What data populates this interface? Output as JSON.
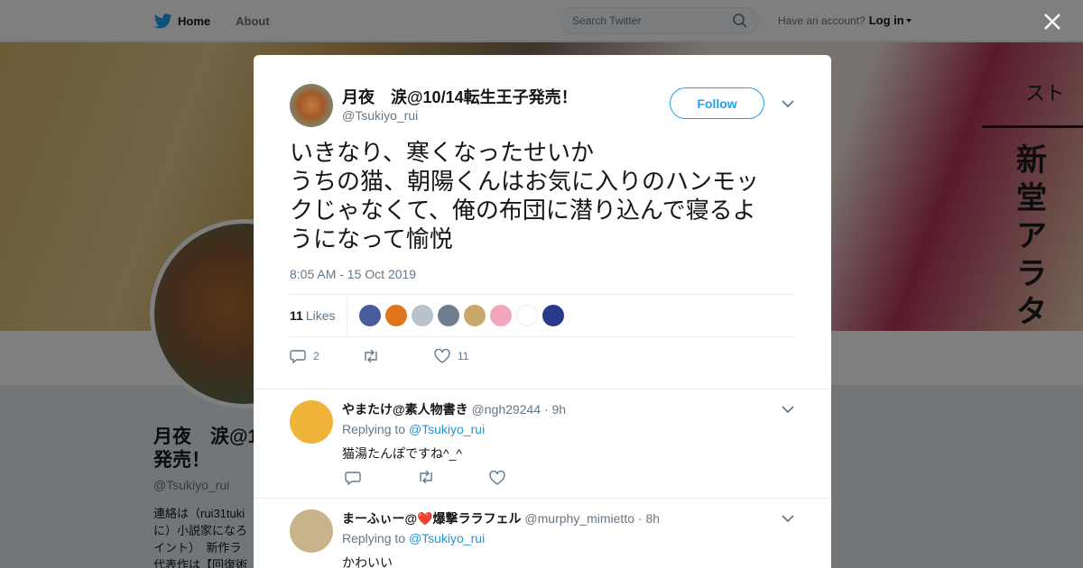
{
  "nav": {
    "home": "Home",
    "about": "About",
    "search_placeholder": "Search Twitter",
    "have_account": "Have an account?",
    "login": "Log in"
  },
  "background": {
    "banner_top": "スト",
    "banner_text": "新堂アラタ",
    "profile_name_line1": "月夜　涙@1",
    "profile_name_line2": "発売！",
    "profile_handle": "@Tsukiyo_rui",
    "bio_lines": [
      "連絡は（rui31tuki",
      "に）小説家になろ",
      "イント）　新作ラ",
      "代表作は【回復術"
    ]
  },
  "tweet": {
    "author_name": "月夜　涙@10/14転生王子発売！",
    "author_handle": "@Tsukiyo_rui",
    "follow_label": "Follow",
    "text_lines": [
      "いきなり、寒くなったせいか",
      "うちの猫、朝陽くんはお気に入りのハンモッ",
      "クじゃなくて、俺の布団に潜り込んで寝るよ",
      "うになって愉悦"
    ],
    "timestamp": "8:05 AM - 15 Oct 2019",
    "likes_count": "11",
    "likes_label": "Likes",
    "reply_count": "2",
    "like_count": "11"
  },
  "likers": [
    {
      "color": "#4a5b9c",
      "icon": "avatar"
    },
    {
      "color": "#e0761c",
      "icon": "avatar"
    },
    {
      "color": "#b8c2cc",
      "icon": "avatar"
    },
    {
      "color": "#6f7d8f",
      "icon": "avatar"
    },
    {
      "color": "#c9a86b",
      "icon": "avatar"
    },
    {
      "color": "#f2a7bd",
      "icon": "avatar"
    },
    {
      "color": "#ffffff",
      "icon": "avatar"
    },
    {
      "color": "#2a3a8a",
      "icon": "avatar"
    }
  ],
  "replies": [
    {
      "name": "やまたけ@素人物書き",
      "handle": "@ngh29244",
      "time": "9h",
      "replying_label": "Replying to",
      "replying_to": "@Tsukiyo_rui",
      "text": "猫湯たんぽですね^_^",
      "avatar_color": "#f0b33a"
    },
    {
      "name": "まーふぃー@❤️爆撃ララフェル",
      "handle": "@murphy_mimietto",
      "time": "8h",
      "replying_label": "Replying to",
      "replying_to": "@Tsukiyo_rui",
      "text": "かわいい",
      "avatar_color": "#c9b38a"
    }
  ]
}
